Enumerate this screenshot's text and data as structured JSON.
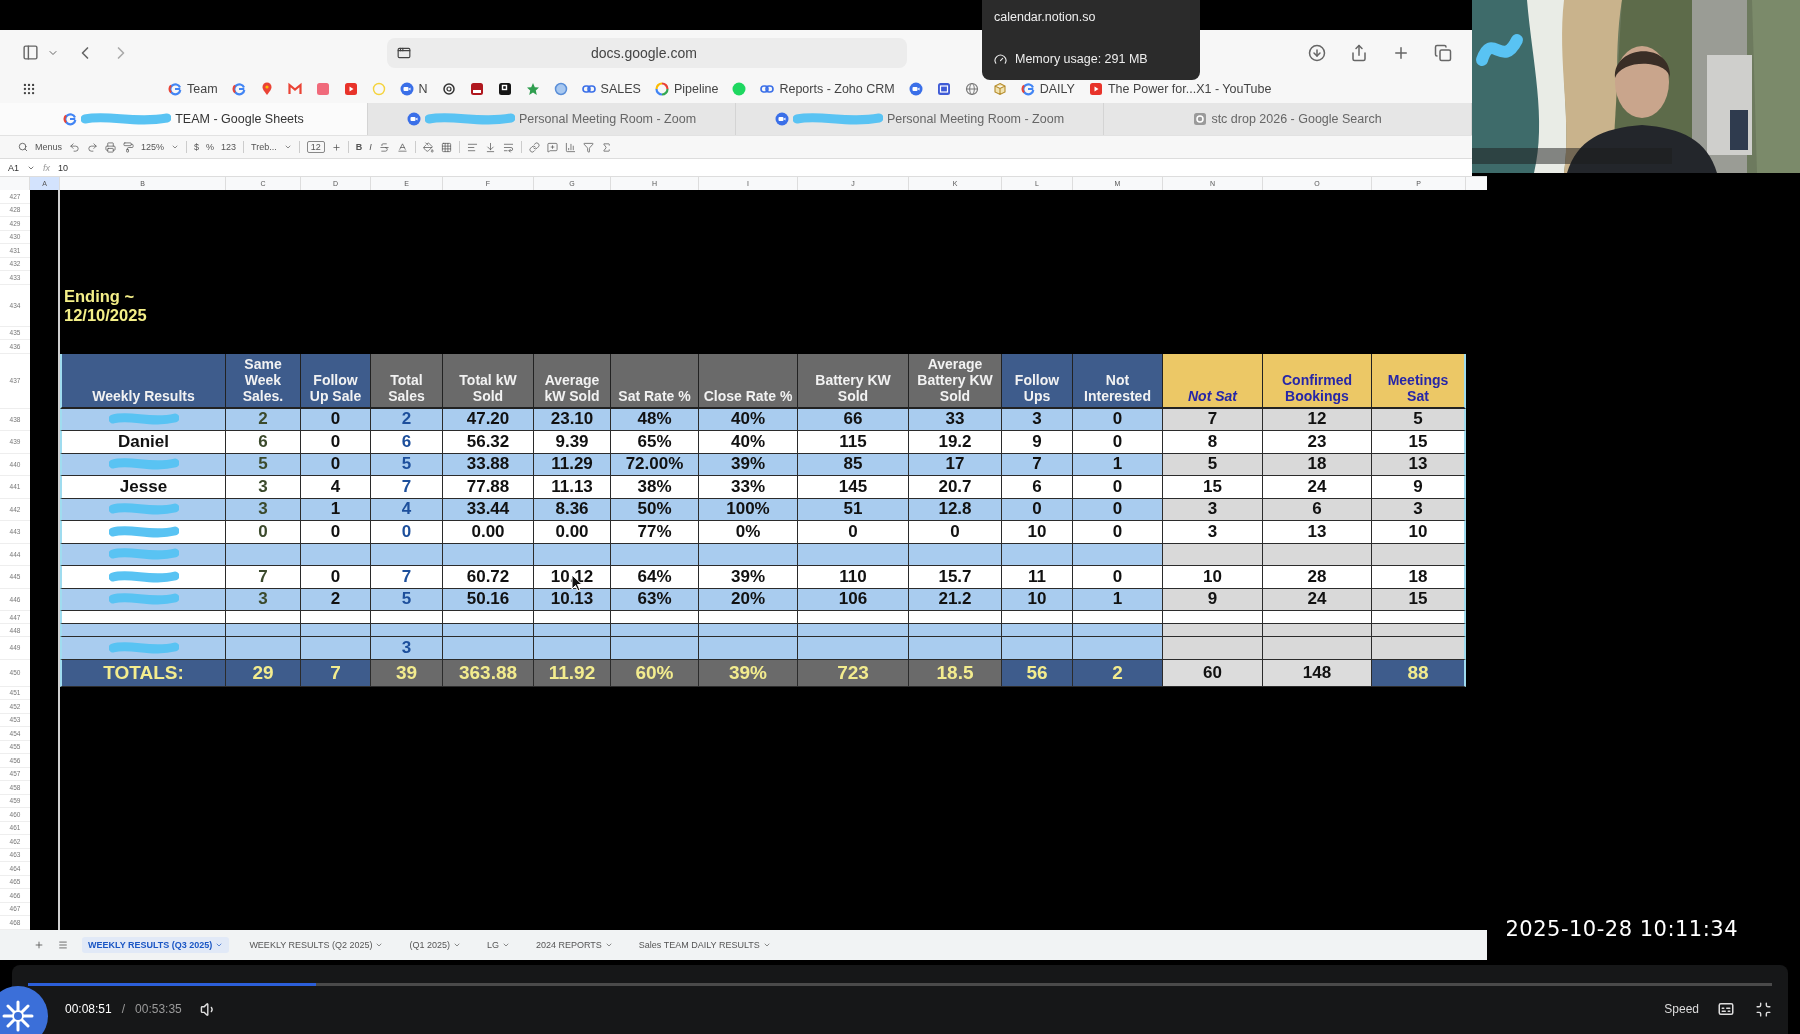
{
  "tooltip": {
    "title": "calendar.notion.so",
    "memory": "Memory usage: 291 MB"
  },
  "browser": {
    "address": "docs.google.com",
    "bookmarks": [
      {
        "kind": "google",
        "label": "Team"
      },
      {
        "kind": "google"
      },
      {
        "kind": "maps"
      },
      {
        "kind": "gmail"
      },
      {
        "kind": "pink-square"
      },
      {
        "kind": "video"
      },
      {
        "kind": "yellow-ring"
      },
      {
        "kind": "zoom",
        "label": "N"
      },
      {
        "kind": "knot"
      },
      {
        "kind": "red-square"
      },
      {
        "kind": "black-square"
      },
      {
        "kind": "star"
      },
      {
        "kind": "blue-ring"
      },
      {
        "kind": "link",
        "label": "SALES"
      },
      {
        "kind": "color-ring",
        "label": "Pipeline"
      },
      {
        "kind": "green-circle"
      },
      {
        "kind": "link",
        "label": "Reports - Zoho CRM"
      },
      {
        "kind": "zoom"
      },
      {
        "kind": "blue-square"
      },
      {
        "kind": "globe"
      },
      {
        "kind": "cube"
      },
      {
        "kind": "google",
        "label": "DAILY"
      },
      {
        "kind": "video",
        "label": "The Power for...X1 - YouTube"
      }
    ],
    "tabs": [
      {
        "kind": "google",
        "redacted": true,
        "label": "TEAM - Google Sheets",
        "selected": true
      },
      {
        "kind": "zoom",
        "redacted": true,
        "label": "Personal Meeting Room - Zoom",
        "selected": false
      },
      {
        "kind": "zoom",
        "redacted": true,
        "label": "Personal Meeting Room - Zoom",
        "selected": false
      },
      {
        "kind": "grey-g",
        "redacted": false,
        "label": "stc drop 2026 - Google Search",
        "selected": false
      }
    ]
  },
  "sheet": {
    "toolbar": {
      "search": "Menus",
      "zoom": "125%",
      "currency": "$",
      "percent": "%",
      "number_format": "123",
      "font": "Treb...",
      "font_size": "12",
      "bold": "B",
      "italic": "I"
    },
    "formula_bar": {
      "cell": "A1",
      "fx": "fx",
      "value": "10"
    },
    "columns": [
      {
        "label": "A",
        "selected": true
      },
      {
        "label": "B",
        "selected": false
      },
      {
        "label": "C",
        "selected": false
      },
      {
        "label": "D",
        "selected": false
      },
      {
        "label": "E",
        "selected": false
      },
      {
        "label": "F",
        "selected": false
      },
      {
        "label": "G",
        "selected": false
      },
      {
        "label": "H",
        "selected": false
      },
      {
        "label": "I",
        "selected": false
      },
      {
        "label": "J",
        "selected": false
      },
      {
        "label": "K",
        "selected": false
      },
      {
        "label": "L",
        "selected": false
      },
      {
        "label": "M",
        "selected": false
      },
      {
        "label": "N",
        "selected": false
      },
      {
        "label": "O",
        "selected": false
      },
      {
        "label": "P",
        "selected": false
      }
    ],
    "rows": [
      {
        "number": "427",
        "kind": "blank"
      },
      {
        "number": "428",
        "kind": "blank"
      },
      {
        "number": "429",
        "kind": "blank"
      },
      {
        "number": "430",
        "kind": "blank"
      },
      {
        "number": "431",
        "kind": "blank"
      },
      {
        "number": "432",
        "kind": "blank"
      },
      {
        "number": "433",
        "kind": "blank"
      },
      {
        "number": "434",
        "kind": "title",
        "lines": [
          "Ending ~",
          "12/10/2025"
        ]
      },
      {
        "number": "435",
        "kind": "blank"
      },
      {
        "number": "436",
        "kind": "blank"
      },
      {
        "number": "437",
        "kind": "header",
        "columns": [
          {
            "label": "Weekly Results",
            "kind": "blue"
          },
          {
            "label": "Same Week Sales.",
            "kind": "blue"
          },
          {
            "label": "Follow Up Sale",
            "kind": "blue"
          },
          {
            "label": "Total Sales",
            "kind": "grey"
          },
          {
            "label": "Total kW Sold",
            "kind": "grey"
          },
          {
            "label": "Average kW Sold",
            "kind": "grey"
          },
          {
            "label": "Sat Rate  %",
            "kind": "grey"
          },
          {
            "label": "Close Rate %",
            "kind": "grey"
          },
          {
            "label": "Battery KW Sold",
            "kind": "grey"
          },
          {
            "label": "Average Battery KW Sold",
            "kind": "grey"
          },
          {
            "label": "Follow Ups",
            "kind": "blue"
          },
          {
            "label": "Not Interested",
            "kind": "blue"
          },
          {
            "label": "Not Sat",
            "kind": "gold",
            "italic": true
          },
          {
            "label": "Confirmed Bookings",
            "kind": "gold",
            "italic": false
          },
          {
            "label": "Meetings Sat",
            "kind": "gold",
            "italic": false
          }
        ]
      },
      {
        "number": "438",
        "kind": "data",
        "shaded": true,
        "redacted": true,
        "cells": [
          "2",
          "0",
          "2",
          "47.20",
          "23.10",
          "48%",
          "40%",
          "66",
          "33",
          "3",
          "0",
          "7",
          "12",
          "5"
        ]
      },
      {
        "number": "439",
        "kind": "data",
        "shaded": false,
        "redacted": false,
        "name": "Daniel",
        "cells": [
          "6",
          "0",
          "6",
          "56.32",
          "9.39",
          "65%",
          "40%",
          "115",
          "19.2",
          "9",
          "0",
          "8",
          "23",
          "15"
        ]
      },
      {
        "number": "440",
        "kind": "data",
        "shaded": true,
        "redacted": true,
        "cells": [
          "5",
          "0",
          "5",
          "33.88",
          "11.29",
          "72.00%",
          "39%",
          "85",
          "17",
          "7",
          "1",
          "5",
          "18",
          "13"
        ]
      },
      {
        "number": "441",
        "kind": "data",
        "shaded": false,
        "redacted": false,
        "name": "Jesse",
        "cells": [
          "3",
          "4",
          "7",
          "77.88",
          "11.13",
          "38%",
          "33%",
          "145",
          "20.7",
          "6",
          "0",
          "15",
          "24",
          "9"
        ]
      },
      {
        "number": "442",
        "kind": "data",
        "shaded": true,
        "redacted": true,
        "cells": [
          "3",
          "1",
          "4",
          "33.44",
          "8.36",
          "50%",
          "100%",
          "51",
          "12.8",
          "0",
          "0",
          "3",
          "6",
          "3"
        ]
      },
      {
        "number": "443",
        "kind": "data",
        "shaded": false,
        "redacted": true,
        "cells": [
          "0",
          "0",
          "0",
          "0.00",
          "0.00",
          "77%",
          "0%",
          "0",
          "0",
          "10",
          "0",
          "3",
          "13",
          "10"
        ]
      },
      {
        "number": "444",
        "kind": "data",
        "shaded": true,
        "redacted": true
      },
      {
        "number": "445",
        "kind": "data",
        "shaded": false,
        "redacted": true,
        "cells": [
          "7",
          "0",
          "7",
          "60.72",
          "10.12",
          "64%",
          "39%",
          "110",
          "15.7",
          "11",
          "0",
          "10",
          "28",
          "18"
        ]
      },
      {
        "number": "446",
        "kind": "data",
        "shaded": true,
        "redacted": true,
        "cells": [
          "3",
          "2",
          "5",
          "50.16",
          "10.13",
          "63%",
          "20%",
          "106",
          "21.2",
          "10",
          "1",
          "9",
          "24",
          "15"
        ]
      },
      {
        "number": "447",
        "kind": "spacer",
        "shaded": false
      },
      {
        "number": "448",
        "kind": "spacer",
        "shaded": true
      },
      {
        "number": "449",
        "kind": "data",
        "shaded": true,
        "redacted": true,
        "cells": [
          null,
          null,
          "3",
          null,
          null,
          null,
          null,
          null,
          null,
          null,
          null,
          null,
          null,
          null
        ]
      },
      {
        "number": "450",
        "kind": "totals",
        "label": "TOTALS:",
        "cells": [
          {
            "value": "29",
            "kind": "blue"
          },
          {
            "value": "7",
            "kind": "blue"
          },
          {
            "value": "39",
            "kind": "grey"
          },
          {
            "value": "363.88",
            "kind": "grey"
          },
          {
            "value": "11.92",
            "kind": "grey"
          },
          {
            "value": "60%",
            "kind": "grey"
          },
          {
            "value": "39%",
            "kind": "grey"
          },
          {
            "value": "723",
            "kind": "grey"
          },
          {
            "value": "18.5",
            "kind": "grey"
          },
          {
            "value": "56",
            "kind": "blue"
          },
          {
            "value": "2",
            "kind": "blue"
          },
          {
            "value": "60",
            "kind": "plain"
          },
          {
            "value": "148",
            "kind": "plain"
          },
          {
            "value": "88",
            "kind": "blue"
          }
        ]
      },
      {
        "number": "451",
        "kind": "blank"
      },
      {
        "number": "452",
        "kind": "blank"
      },
      {
        "number": "453",
        "kind": "blank"
      },
      {
        "number": "454",
        "kind": "blank"
      },
      {
        "number": "455",
        "kind": "blank"
      },
      {
        "number": "456",
        "kind": "blank"
      },
      {
        "number": "457",
        "kind": "blank"
      },
      {
        "number": "458",
        "kind": "blank"
      },
      {
        "number": "459",
        "kind": "blank"
      },
      {
        "number": "460",
        "kind": "blank"
      },
      {
        "number": "461",
        "kind": "blank"
      },
      {
        "number": "462",
        "kind": "blank"
      },
      {
        "number": "463",
        "kind": "blank"
      },
      {
        "number": "464",
        "kind": "blank"
      },
      {
        "number": "465",
        "kind": "blank"
      },
      {
        "number": "466",
        "kind": "blank"
      },
      {
        "number": "467",
        "kind": "blank"
      },
      {
        "number": "468",
        "kind": "blank"
      }
    ],
    "sheet_tabs": [
      {
        "label": "WEEKLY RESULTS (Q3 2025)",
        "selected": true
      },
      {
        "label": "WEEKLY RESULTS (Q2 2025)",
        "selected": false
      },
      {
        "label": "(Q1 2025)",
        "selected": false
      },
      {
        "label": "LG",
        "selected": false
      },
      {
        "label": "2024 REPORTS",
        "selected": false
      },
      {
        "label": "Sales TEAM DAILY RESULTS",
        "selected": false
      }
    ]
  },
  "timestamp": "2025-10-28 10:11:34",
  "player": {
    "elapsed": "00:08:51",
    "separator": "/",
    "duration": "00:53:35",
    "level": 0.165,
    "speed": "Speed"
  }
}
